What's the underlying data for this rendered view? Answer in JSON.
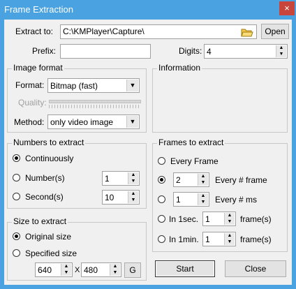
{
  "window": {
    "title": "Frame Extraction",
    "close_glyph": "×"
  },
  "extract_to": {
    "label": "Extract to:",
    "value": "C:\\KMPlayer\\Capture\\",
    "open_label": "Open",
    "folder_icon": "folder-icon"
  },
  "prefix": {
    "label": "Prefix:",
    "value": ""
  },
  "digits": {
    "label": "Digits:",
    "value": "4"
  },
  "image_format": {
    "title": "Image format",
    "format_label": "Format:",
    "format_value": "Bitmap (fast)",
    "quality_label": "Quality:",
    "method_label": "Method:",
    "method_value": "only video image"
  },
  "information": {
    "title": "Information"
  },
  "numbers": {
    "title": "Numbers to extract",
    "continuously": "Continuously",
    "numbers_label": "Number(s)",
    "numbers_value": "1",
    "seconds_label": "Second(s)",
    "seconds_value": "10",
    "selected": "continuously"
  },
  "size": {
    "title": "Size to extract",
    "original": "Original size",
    "specified": "Specified size",
    "width": "640",
    "x": "X",
    "height": "480",
    "g_label": "G",
    "selected": "original"
  },
  "frames": {
    "title": "Frames to extract",
    "every_frame": "Every Frame",
    "every_n_value": "2",
    "every_n_label": "Every # frame",
    "every_ms_value": "1",
    "every_ms_label": "Every # ms",
    "in_sec_label": "In 1sec.",
    "in_sec_value": "1",
    "in_sec_unit": "frame(s)",
    "in_min_label": "In 1min.",
    "in_min_value": "1",
    "in_min_unit": "frame(s)",
    "selected": "every_n_frame"
  },
  "actions": {
    "start": "Start",
    "close": "Close"
  },
  "colors": {
    "titlebar": "#4aa3e0",
    "close": "#c8453c",
    "client": "#f0f0f0"
  }
}
